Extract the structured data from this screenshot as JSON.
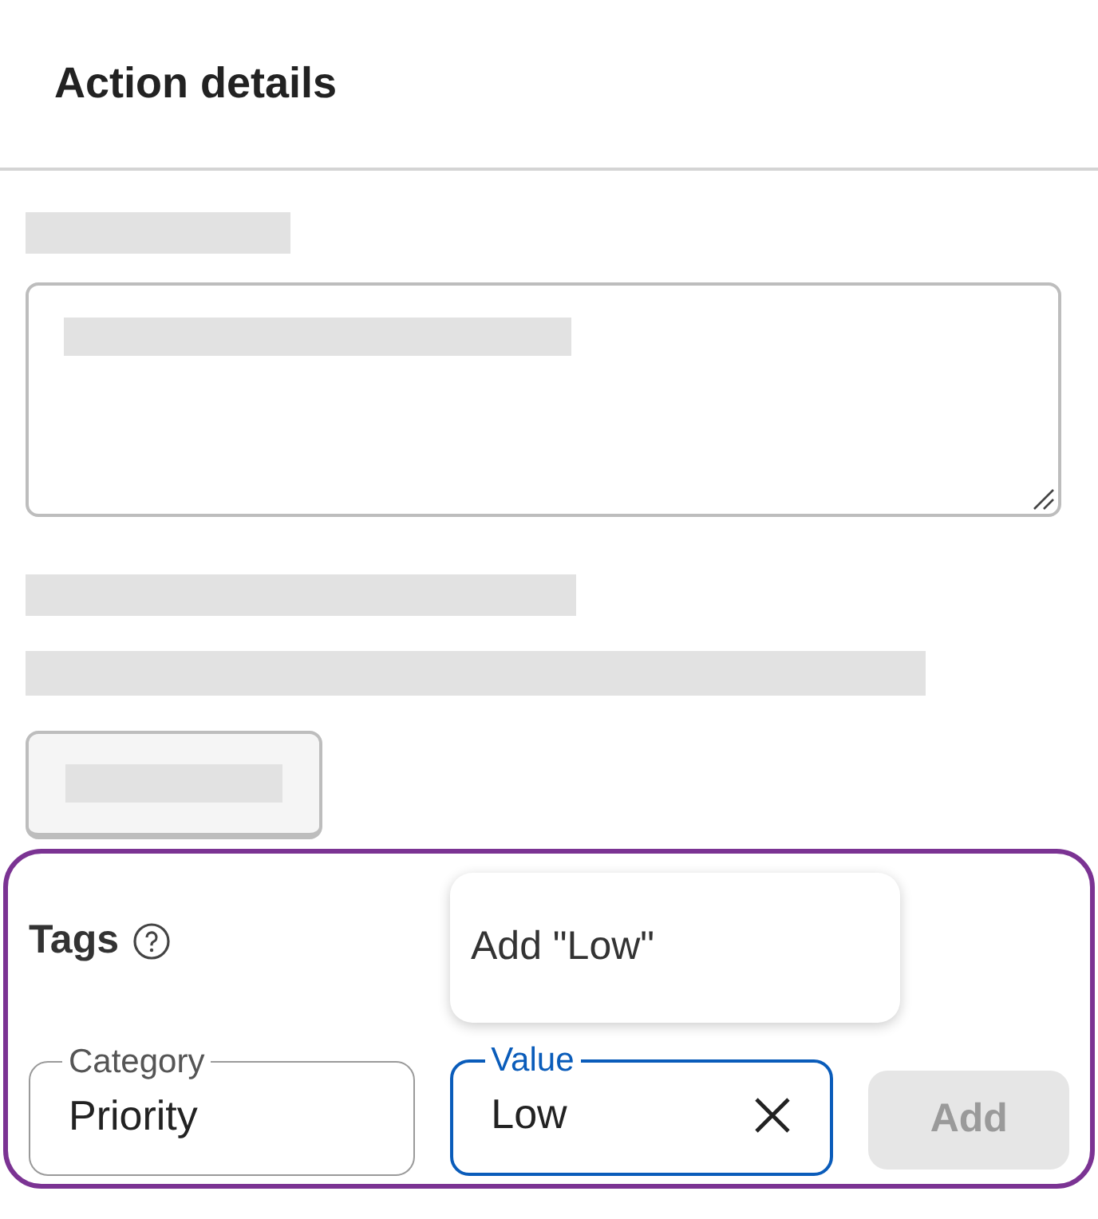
{
  "header": {
    "title": "Action details"
  },
  "tags": {
    "label": "Tags",
    "category_field": {
      "label": "Category",
      "value": "Priority",
      "focused": false
    },
    "value_field": {
      "label": "Value",
      "value": "Low",
      "focused": true
    },
    "suggestion": {
      "text": "Add \"Low\""
    },
    "add_button": {
      "label": "Add",
      "disabled": true
    }
  }
}
